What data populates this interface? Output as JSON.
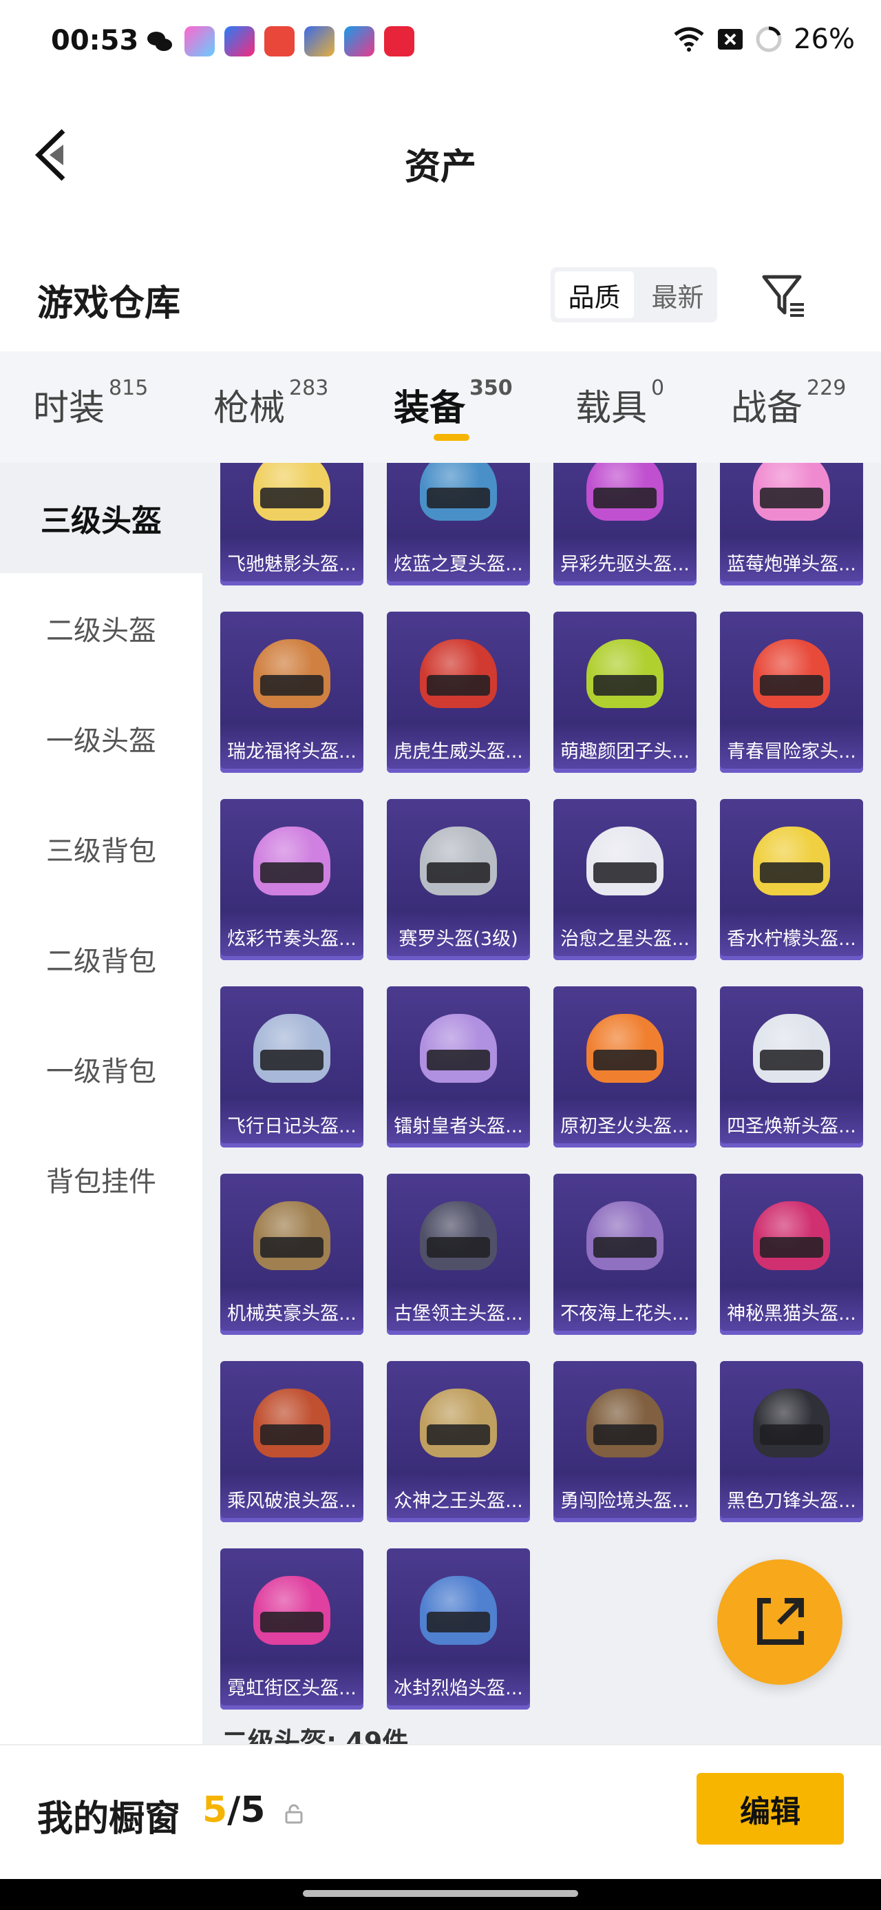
{
  "status_bar": {
    "time": "00:53",
    "battery": "26%"
  },
  "nav": {
    "title": "资产"
  },
  "section": {
    "title": "游戏仓库"
  },
  "sort": {
    "options": [
      "品质",
      "最新"
    ],
    "selected": "品质"
  },
  "tabs": [
    {
      "label": "时装",
      "count": "815"
    },
    {
      "label": "枪械",
      "count": "283"
    },
    {
      "label": "装备",
      "count": "350",
      "active": true
    },
    {
      "label": "载具",
      "count": "0"
    },
    {
      "label": "战备",
      "count": "229"
    }
  ],
  "sidebar": [
    {
      "label": "三级头盔",
      "active": true
    },
    {
      "label": "二级头盔"
    },
    {
      "label": "一级头盔"
    },
    {
      "label": "三级背包"
    },
    {
      "label": "二级背包"
    },
    {
      "label": "一级背包"
    },
    {
      "label": "背包挂件"
    }
  ],
  "items": [
    {
      "name": "飞驰魅影头盔...",
      "color": "#f0d060"
    },
    {
      "name": "炫蓝之夏头盔...",
      "color": "#4a90c8"
    },
    {
      "name": "异彩先驱头盔...",
      "color": "#c050d0"
    },
    {
      "name": "蓝莓炮弹头盔...",
      "color": "#f08ad0"
    },
    {
      "name": "瑞龙福将头盔...",
      "color": "#d08040"
    },
    {
      "name": "虎虎生威头盔...",
      "color": "#d03a30"
    },
    {
      "name": "萌趣颜团子头...",
      "color": "#b0d030"
    },
    {
      "name": "青春冒险家头...",
      "color": "#e84a3a"
    },
    {
      "name": "炫彩节奏头盔...",
      "color": "#d080e0"
    },
    {
      "name": "赛罗头盔(3级)",
      "color": "#b8bcc4"
    },
    {
      "name": "治愈之星头盔...",
      "color": "#e8e8f0"
    },
    {
      "name": "香水柠檬头盔...",
      "color": "#f0d040"
    },
    {
      "name": "飞行日记头盔...",
      "color": "#a8b8d8"
    },
    {
      "name": "镭射皇者头盔...",
      "color": "#b090e0"
    },
    {
      "name": "原初圣火头盔...",
      "color": "#f08030"
    },
    {
      "name": "四圣焕新头盔...",
      "color": "#e0e4ec"
    },
    {
      "name": "机械英豪头盔...",
      "color": "#a08050"
    },
    {
      "name": "古堡领主头盔...",
      "color": "#505068"
    },
    {
      "name": "不夜海上花头...",
      "color": "#9070c0"
    },
    {
      "name": "神秘黑猫头盔...",
      "color": "#d03070"
    },
    {
      "name": "乘风破浪头盔...",
      "color": "#c05030"
    },
    {
      "name": "众神之王头盔...",
      "color": "#c0a060"
    },
    {
      "name": "勇闯险境头盔...",
      "color": "#806040"
    },
    {
      "name": "黑色刀锋头盔...",
      "color": "#303038"
    },
    {
      "name": "霓虹街区头盔...",
      "color": "#e040a0"
    },
    {
      "name": "冰封烈焰头盔...",
      "color": "#5080d0"
    }
  ],
  "next_section": "二级头盔: 49件",
  "bottom": {
    "title": "我的橱窗",
    "count_current": "5",
    "count_sep": "/",
    "count_total": "5",
    "edit_label": "编辑"
  },
  "colors": {
    "accent": "#f7b500",
    "card_bg": "#3a2d78"
  }
}
